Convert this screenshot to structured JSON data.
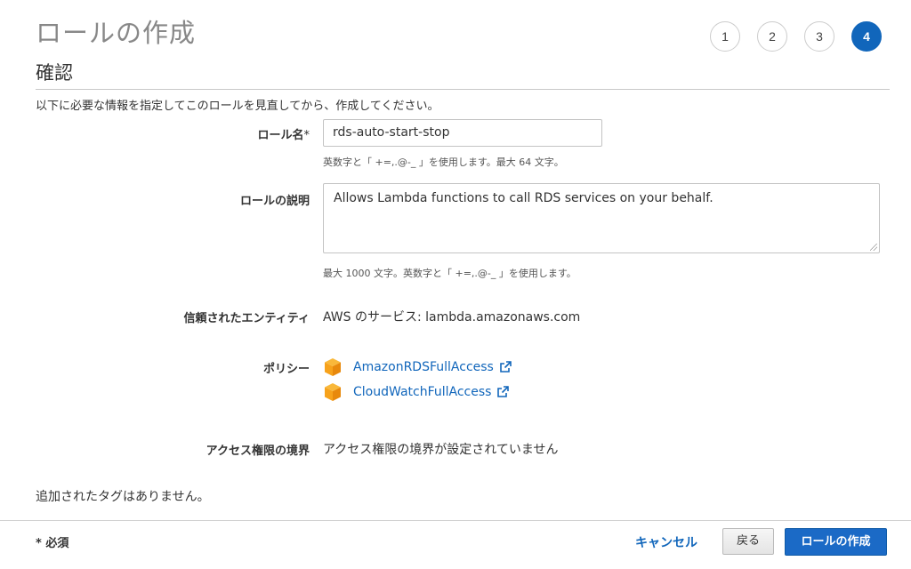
{
  "page": {
    "title": "ロールの作成"
  },
  "steps": [
    "1",
    "2",
    "3",
    "4"
  ],
  "active_step": "4",
  "section": {
    "title": "確認",
    "intro": "以下に必要な情報を指定してこのロールを見直してから、作成してください。"
  },
  "form": {
    "role_name": {
      "label": "ロール名",
      "required_mark": "*",
      "value": "rds-auto-start-stop",
      "hint": "英数字と「 +=,.@-_ 」を使用します。最大 64 文字。"
    },
    "role_description": {
      "label": "ロールの説明",
      "value": "Allows Lambda functions to call RDS services on your behalf.",
      "hint": "最大 1000 文字。英数字と「 +=,.@-_ 」を使用します。"
    },
    "trusted_entity": {
      "label": "信頼されたエンティティ",
      "value": "AWS のサービス: lambda.amazonaws.com"
    },
    "policies": {
      "label": "ポリシー",
      "items": [
        {
          "name": "AmazonRDSFullAccess",
          "icon": "policy-cube-icon"
        },
        {
          "name": "CloudWatchFullAccess",
          "icon": "policy-cube-icon"
        }
      ]
    },
    "permissions_boundary": {
      "label": "アクセス権限の境界",
      "value": "アクセス権限の境界が設定されていません"
    }
  },
  "tags_note": "追加されたタグはありません。",
  "footer": {
    "required_note": "* 必須",
    "cancel_label": "キャンセル",
    "back_label": "戻る",
    "create_label": "ロールの作成"
  },
  "colors": {
    "accent": "#1166bb",
    "primary_button": "#1b6ac6",
    "policy_icon": "#f7a21b"
  }
}
